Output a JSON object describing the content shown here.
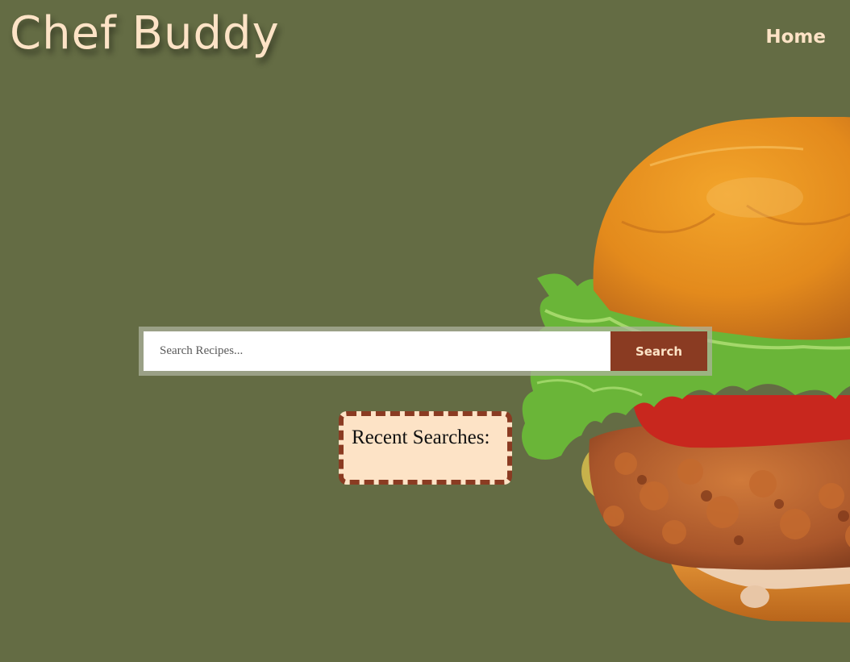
{
  "header": {
    "brand": "Chef Buddy",
    "nav": [
      {
        "label": "Home"
      }
    ]
  },
  "search": {
    "placeholder": "Search Recipes...",
    "value": "",
    "button_label": "Search"
  },
  "recent": {
    "title": "Recent Searches:",
    "items": []
  },
  "colors": {
    "background": "#646c44",
    "accent": "#8a3b22",
    "cream": "#fde3c6"
  },
  "hero_image": {
    "icon": "chicken-burger-image"
  }
}
